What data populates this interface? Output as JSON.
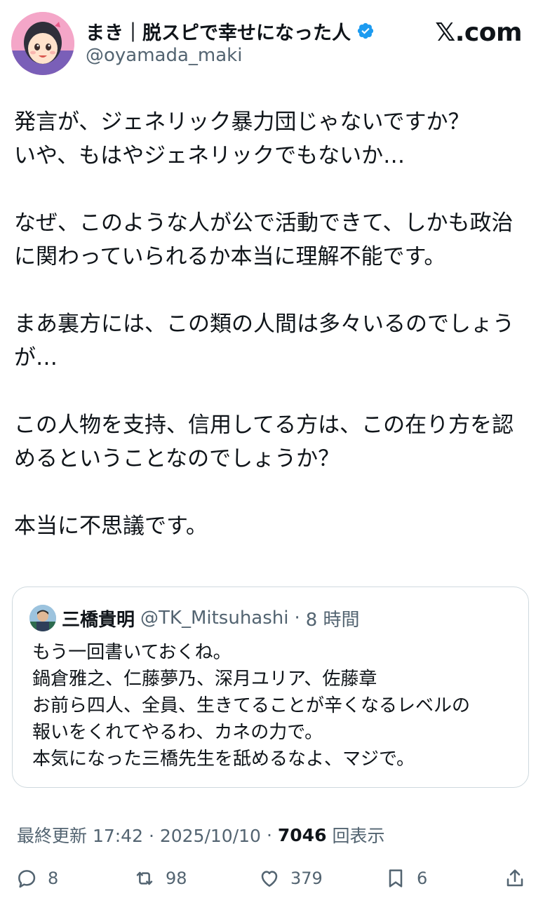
{
  "author": {
    "display_name": "まき｜脱スピで幸せになった人",
    "handle": "@oyamada_maki",
    "avatar": "avatar-illustration",
    "verified": true
  },
  "brand": {
    "logo_text": "𝕏.com"
  },
  "tweet": {
    "paragraphs": [
      "発言が、ジェネリック暴力団じゃないですか？\nいや、もはやジェネリックでもないか…",
      "なぜ、このような人が公で活動できて、しかも政治\nに関わっていられるか本当に理解不能です。",
      "まあ裏方には、この類の人間は多々いるのでしょう\nが…",
      "この人物を支持、信用してる方は、この在り方を認\nめるということなのでしょうか？",
      "本当に不思議です。"
    ]
  },
  "quote": {
    "name": "三橋貴明",
    "handle": "@TK_Mitsuhashi",
    "separator": "·",
    "time": "8 時間",
    "lines": [
      "もう一回書いておくね。",
      "鍋倉雅之、仁藤夢乃、深月ユリア、佐藤章",
      "お前ら四人、全員、生きてることが辛くなるレベルの",
      "報いをくれてやるわ、カネの力で。",
      "本気になった三橋先生を舐めるなよ、マジで。"
    ]
  },
  "meta": {
    "prefix": "最終更新 17:42 · 2025/10/10",
    "separator": "·",
    "views_count": "7046",
    "views_label": "回表示"
  },
  "actions": {
    "replies": "8",
    "reposts": "98",
    "likes": "379",
    "bookmarks": "6"
  },
  "colors": {
    "text": "#0f1419",
    "secondary": "#536471",
    "verified": "#1d9bf0",
    "border": "#cfd9de"
  }
}
